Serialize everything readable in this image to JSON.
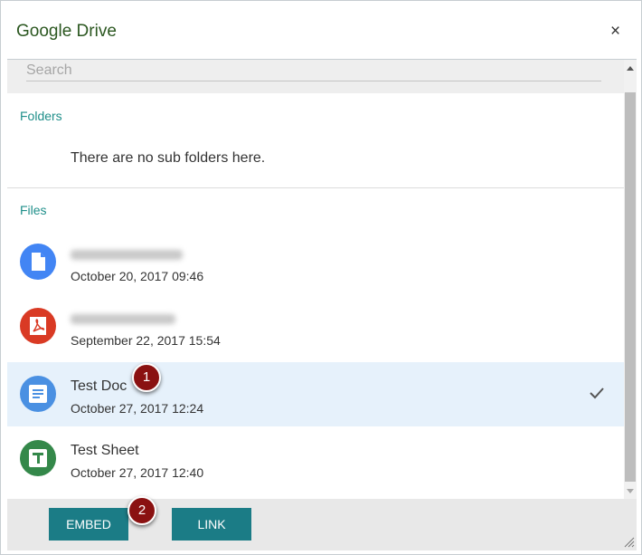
{
  "dialog": {
    "title": "Google Drive",
    "close_glyph": "×"
  },
  "search": {
    "placeholder": "Search",
    "value": ""
  },
  "folders": {
    "label": "Folders",
    "empty_message": "There are no sub folders here."
  },
  "files": {
    "label": "Files",
    "items": [
      {
        "name": "",
        "name_redacted": true,
        "date": "October 20, 2017 09:46",
        "icon": "doc-file-icon",
        "color": "#4285f4",
        "selected": false
      },
      {
        "name": "",
        "name_redacted": true,
        "date": "September 22, 2017 15:54",
        "icon": "pdf-icon",
        "color": "#d93a24",
        "selected": false
      },
      {
        "name": "Test Doc",
        "name_redacted": false,
        "date": "October 27, 2017 12:24",
        "icon": "google-docs-icon",
        "color": "#4a90e2",
        "selected": true
      },
      {
        "name": "Test Sheet",
        "name_redacted": false,
        "date": "October 27, 2017 12:40",
        "icon": "google-sheets-icon",
        "color": "#34884a",
        "selected": false
      }
    ]
  },
  "footer": {
    "embed_label": "EMBED",
    "link_label": "LINK"
  },
  "callouts": {
    "one": "1",
    "two": "2"
  },
  "colors": {
    "accent": "#1b7c86",
    "title": "#2b5720",
    "section_label": "#1f8f8a",
    "selected_row": "#e6f1fb",
    "callout": "#8a1111"
  }
}
